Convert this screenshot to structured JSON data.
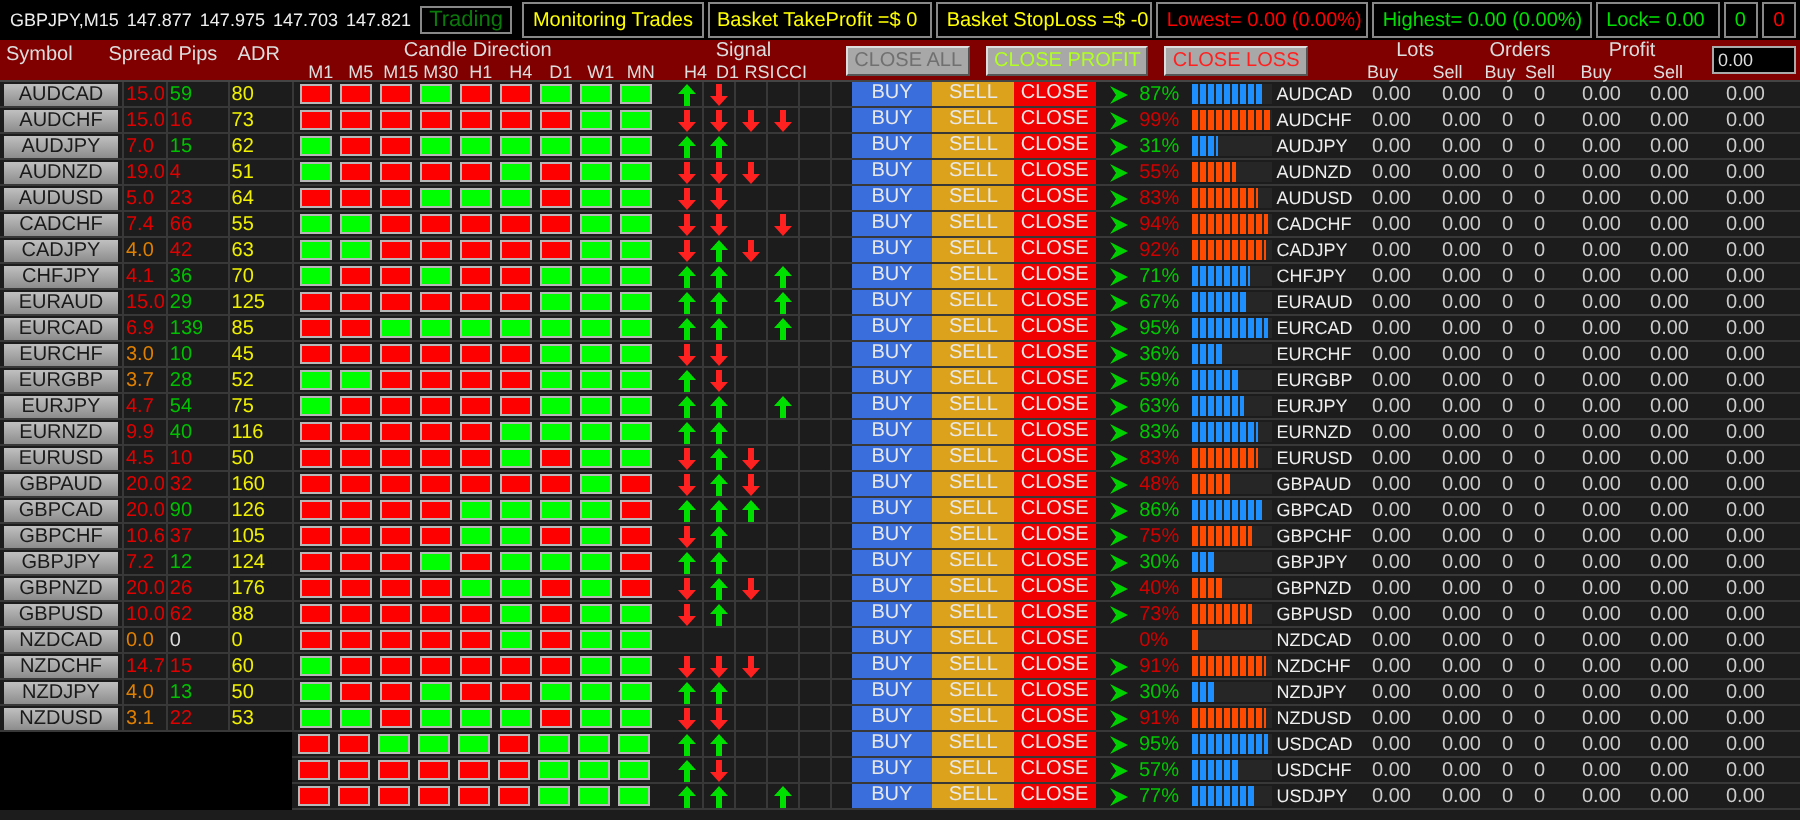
{
  "chart_info": {
    "symbol_timeframe": "GBPJPY,M15",
    "quotes": [
      "147.877",
      "147.975",
      "147.703",
      "147.821"
    ],
    "mode": "Trading"
  },
  "top_panels": [
    {
      "text": "Monitoring Trades",
      "color": "#ffff00"
    },
    {
      "text": "Basket TakeProfit =$ 0",
      "color": "#ffff00"
    },
    {
      "text": "Basket StopLoss =$ -0",
      "color": "#ffff00"
    },
    {
      "text": "Lowest= 0.00 (0.00%)",
      "color": "#ff0000"
    },
    {
      "text": "Highest= 0.00 (0.00%)",
      "color": "#00e000"
    },
    {
      "text": "Lock= 0.00",
      "color": "#00e000"
    }
  ],
  "counters": [
    {
      "text": "0",
      "color": "#00e000"
    },
    {
      "text": "0",
      "color": "#ff0000"
    }
  ],
  "header": {
    "columns": [
      "Symbol",
      "Spread",
      "Pips",
      "ADR"
    ],
    "candle_title": "Candle Direction",
    "timeframes": [
      "M1",
      "M5",
      "M15",
      "M30",
      "H1",
      "H4",
      "D1",
      "W1",
      "MN"
    ],
    "signal_title": "Signal",
    "signal_names": [
      "H4",
      "D1",
      "RSI",
      "CCI"
    ],
    "actions": [
      {
        "label": "CLOSE ALL",
        "kind": "all"
      },
      {
        "label": "CLOSE PROFIT",
        "kind": "profit"
      },
      {
        "label": "CLOSE LOSS",
        "kind": "loss"
      }
    ],
    "groups": [
      {
        "title": "Lots",
        "sub": [
          "Buy",
          "Sell"
        ]
      },
      {
        "title": "Orders",
        "sub": [
          "Buy",
          "Sell"
        ]
      },
      {
        "title": "Profit",
        "sub": [
          "Buy",
          "Sell"
        ]
      }
    ],
    "total_field": "0.00"
  },
  "rows": [
    {
      "symbol": "AUDCAD",
      "spread": {
        "text": "15.0",
        "color": "#e00000"
      },
      "pips": {
        "text": "59",
        "color": "#00c000"
      },
      "adr": "80",
      "candles_bullish": [
        false,
        false,
        false,
        true,
        false,
        false,
        true,
        true,
        true
      ],
      "signals": [
        {
          "kind": "up"
        },
        {
          "kind": "down"
        },
        {
          "kind": "none"
        },
        {
          "kind": "none"
        }
      ],
      "buttons": [
        "BUY",
        "SELL",
        "CLOSE"
      ],
      "arrow": true,
      "strength": "87%",
      "bullish": true,
      "level": 0.87,
      "pair": "AUDCAD",
      "values": [
        "0.00",
        "0.00",
        "0",
        "0",
        "0.00",
        "0.00",
        "0.00"
      ]
    },
    {
      "symbol": "AUDCHF",
      "spread": {
        "text": "15.0",
        "color": "#e00000"
      },
      "pips": {
        "text": "16",
        "color": "#e00000"
      },
      "adr": "73",
      "candles_bullish": [
        false,
        false,
        false,
        false,
        false,
        false,
        false,
        true,
        true
      ],
      "signals": [
        {
          "kind": "down"
        },
        {
          "kind": "down"
        },
        {
          "kind": "down"
        },
        {
          "kind": "down"
        }
      ],
      "buttons": [
        "BUY",
        "SELL",
        "CLOSE"
      ],
      "arrow": true,
      "strength": "99%",
      "bullish": false,
      "level": 0.99,
      "pair": "AUDCHF",
      "values": [
        "0.00",
        "0.00",
        "0",
        "0",
        "0.00",
        "0.00",
        "0.00"
      ]
    },
    {
      "symbol": "AUDJPY",
      "spread": {
        "text": "7.0",
        "color": "#e00000"
      },
      "pips": {
        "text": "15",
        "color": "#00c000"
      },
      "adr": "62",
      "candles_bullish": [
        true,
        false,
        false,
        true,
        true,
        true,
        true,
        true,
        true
      ],
      "signals": [
        {
          "kind": "up"
        },
        {
          "kind": "up"
        },
        {
          "kind": "none"
        },
        {
          "kind": "none"
        }
      ],
      "buttons": [
        "BUY",
        "SELL",
        "CLOSE"
      ],
      "arrow": true,
      "strength": "31%",
      "bullish": true,
      "level": 0.31,
      "pair": "AUDJPY",
      "values": [
        "0.00",
        "0.00",
        "0",
        "0",
        "0.00",
        "0.00",
        "0.00"
      ]
    },
    {
      "symbol": "AUDNZD",
      "spread": {
        "text": "19.0",
        "color": "#e00000"
      },
      "pips": {
        "text": "4",
        "color": "#e00000"
      },
      "adr": "51",
      "candles_bullish": [
        true,
        false,
        false,
        false,
        false,
        true,
        false,
        true,
        true
      ],
      "signals": [
        {
          "kind": "down"
        },
        {
          "kind": "down"
        },
        {
          "kind": "down"
        },
        {
          "kind": "none"
        }
      ],
      "buttons": [
        "BUY",
        "SELL",
        "CLOSE"
      ],
      "arrow": true,
      "strength": "55%",
      "bullish": false,
      "level": 0.55,
      "pair": "AUDNZD",
      "values": [
        "0.00",
        "0.00",
        "0",
        "0",
        "0.00",
        "0.00",
        "0.00"
      ]
    },
    {
      "symbol": "AUDUSD",
      "spread": {
        "text": "5.0",
        "color": "#e00000"
      },
      "pips": {
        "text": "23",
        "color": "#e00000"
      },
      "adr": "64",
      "candles_bullish": [
        false,
        false,
        false,
        true,
        true,
        true,
        false,
        true,
        true
      ],
      "signals": [
        {
          "kind": "down"
        },
        {
          "kind": "down"
        },
        {
          "kind": "none"
        },
        {
          "kind": "none"
        }
      ],
      "buttons": [
        "BUY",
        "SELL",
        "CLOSE"
      ],
      "arrow": true,
      "strength": "83%",
      "bullish": false,
      "level": 0.83,
      "pair": "AUDUSD",
      "values": [
        "0.00",
        "0.00",
        "0",
        "0",
        "0.00",
        "0.00",
        "0.00"
      ]
    },
    {
      "symbol": "CADCHF",
      "spread": {
        "text": "7.4",
        "color": "#e00000"
      },
      "pips": {
        "text": "66",
        "color": "#e00000"
      },
      "adr": "55",
      "candles_bullish": [
        true,
        true,
        false,
        false,
        false,
        false,
        false,
        true,
        true
      ],
      "signals": [
        {
          "kind": "down"
        },
        {
          "kind": "down"
        },
        {
          "kind": "none"
        },
        {
          "kind": "down"
        }
      ],
      "buttons": [
        "BUY",
        "SELL",
        "CLOSE"
      ],
      "arrow": true,
      "strength": "94%",
      "bullish": false,
      "level": 0.94,
      "pair": "CADCHF",
      "values": [
        "0.00",
        "0.00",
        "0",
        "0",
        "0.00",
        "0.00",
        "0.00"
      ]
    },
    {
      "symbol": "CADJPY",
      "spread": {
        "text": "4.0",
        "color": "#e08000"
      },
      "pips": {
        "text": "42",
        "color": "#e00000"
      },
      "adr": "63",
      "candles_bullish": [
        true,
        true,
        false,
        false,
        false,
        false,
        false,
        true,
        true
      ],
      "signals": [
        {
          "kind": "down"
        },
        {
          "kind": "up"
        },
        {
          "kind": "down"
        },
        {
          "kind": "none"
        }
      ],
      "buttons": [
        "BUY",
        "SELL",
        "CLOSE"
      ],
      "arrow": true,
      "strength": "92%",
      "bullish": false,
      "level": 0.92,
      "pair": "CADJPY",
      "values": [
        "0.00",
        "0.00",
        "0",
        "0",
        "0.00",
        "0.00",
        "0.00"
      ]
    },
    {
      "symbol": "CHFJPY",
      "spread": {
        "text": "4.1",
        "color": "#e00000"
      },
      "pips": {
        "text": "36",
        "color": "#00c000"
      },
      "adr": "70",
      "candles_bullish": [
        true,
        false,
        false,
        true,
        false,
        false,
        true,
        true,
        true
      ],
      "signals": [
        {
          "kind": "up"
        },
        {
          "kind": "up"
        },
        {
          "kind": "none"
        },
        {
          "kind": "up"
        }
      ],
      "buttons": [
        "BUY",
        "SELL",
        "CLOSE"
      ],
      "arrow": true,
      "strength": "71%",
      "bullish": true,
      "level": 0.71,
      "pair": "CHFJPY",
      "values": [
        "0.00",
        "0.00",
        "0",
        "0",
        "0.00",
        "0.00",
        "0.00"
      ]
    },
    {
      "symbol": "EURAUD",
      "spread": {
        "text": "15.0",
        "color": "#e00000"
      },
      "pips": {
        "text": "29",
        "color": "#00c000"
      },
      "adr": "125",
      "candles_bullish": [
        false,
        false,
        false,
        false,
        false,
        false,
        true,
        true,
        true
      ],
      "signals": [
        {
          "kind": "up"
        },
        {
          "kind": "up"
        },
        {
          "kind": "none"
        },
        {
          "kind": "up"
        }
      ],
      "buttons": [
        "BUY",
        "SELL",
        "CLOSE"
      ],
      "arrow": true,
      "strength": "67%",
      "bullish": true,
      "level": 0.67,
      "pair": "EURAUD",
      "values": [
        "0.00",
        "0.00",
        "0",
        "0",
        "0.00",
        "0.00",
        "0.00"
      ]
    },
    {
      "symbol": "EURCAD",
      "spread": {
        "text": "6.9",
        "color": "#e00000"
      },
      "pips": {
        "text": "139",
        "color": "#00c000"
      },
      "adr": "85",
      "candles_bullish": [
        false,
        false,
        true,
        true,
        true,
        true,
        true,
        true,
        true
      ],
      "signals": [
        {
          "kind": "up"
        },
        {
          "kind": "up"
        },
        {
          "kind": "none"
        },
        {
          "kind": "up"
        }
      ],
      "buttons": [
        "BUY",
        "SELL",
        "CLOSE"
      ],
      "arrow": true,
      "strength": "95%",
      "bullish": true,
      "level": 0.95,
      "pair": "EURCAD",
      "values": [
        "0.00",
        "0.00",
        "0",
        "0",
        "0.00",
        "0.00",
        "0.00"
      ]
    },
    {
      "symbol": "EURCHF",
      "spread": {
        "text": "3.0",
        "color": "#e08000"
      },
      "pips": {
        "text": "10",
        "color": "#00c000"
      },
      "adr": "45",
      "candles_bullish": [
        false,
        false,
        false,
        false,
        false,
        false,
        true,
        true,
        true
      ],
      "signals": [
        {
          "kind": "down"
        },
        {
          "kind": "down"
        },
        {
          "kind": "none"
        },
        {
          "kind": "none"
        }
      ],
      "buttons": [
        "BUY",
        "SELL",
        "CLOSE"
      ],
      "arrow": true,
      "strength": "36%",
      "bullish": true,
      "level": 0.36,
      "pair": "EURCHF",
      "values": [
        "0.00",
        "0.00",
        "0",
        "0",
        "0.00",
        "0.00",
        "0.00"
      ]
    },
    {
      "symbol": "EURGBP",
      "spread": {
        "text": "3.7",
        "color": "#e08000"
      },
      "pips": {
        "text": "28",
        "color": "#00c000"
      },
      "adr": "52",
      "candles_bullish": [
        true,
        true,
        false,
        false,
        false,
        false,
        true,
        true,
        true
      ],
      "signals": [
        {
          "kind": "up"
        },
        {
          "kind": "down"
        },
        {
          "kind": "none"
        },
        {
          "kind": "none"
        }
      ],
      "buttons": [
        "BUY",
        "SELL",
        "CLOSE"
      ],
      "arrow": true,
      "strength": "59%",
      "bullish": true,
      "level": 0.59,
      "pair": "EURGBP",
      "values": [
        "0.00",
        "0.00",
        "0",
        "0",
        "0.00",
        "0.00",
        "0.00"
      ]
    },
    {
      "symbol": "EURJPY",
      "spread": {
        "text": "4.7",
        "color": "#e00000"
      },
      "pips": {
        "text": "54",
        "color": "#00c000"
      },
      "adr": "75",
      "candles_bullish": [
        true,
        false,
        false,
        false,
        false,
        false,
        true,
        true,
        true
      ],
      "signals": [
        {
          "kind": "up"
        },
        {
          "kind": "up"
        },
        {
          "kind": "none"
        },
        {
          "kind": "up"
        }
      ],
      "buttons": [
        "BUY",
        "SELL",
        "CLOSE"
      ],
      "arrow": true,
      "strength": "63%",
      "bullish": true,
      "level": 0.63,
      "pair": "EURJPY",
      "values": [
        "0.00",
        "0.00",
        "0",
        "0",
        "0.00",
        "0.00",
        "0.00"
      ]
    },
    {
      "symbol": "EURNZD",
      "spread": {
        "text": "9.9",
        "color": "#e00000"
      },
      "pips": {
        "text": "40",
        "color": "#00c000"
      },
      "adr": "116",
      "candles_bullish": [
        false,
        false,
        false,
        false,
        false,
        true,
        true,
        true,
        true
      ],
      "signals": [
        {
          "kind": "up"
        },
        {
          "kind": "up"
        },
        {
          "kind": "none"
        },
        {
          "kind": "none"
        }
      ],
      "buttons": [
        "BUY",
        "SELL",
        "CLOSE"
      ],
      "arrow": true,
      "strength": "83%",
      "bullish": true,
      "level": 0.83,
      "pair": "EURNZD",
      "values": [
        "0.00",
        "0.00",
        "0",
        "0",
        "0.00",
        "0.00",
        "0.00"
      ]
    },
    {
      "symbol": "EURUSD",
      "spread": {
        "text": "4.5",
        "color": "#e00000"
      },
      "pips": {
        "text": "10",
        "color": "#e00000"
      },
      "adr": "50",
      "candles_bullish": [
        false,
        false,
        false,
        false,
        false,
        true,
        false,
        true,
        true
      ],
      "signals": [
        {
          "kind": "down"
        },
        {
          "kind": "up"
        },
        {
          "kind": "down"
        },
        {
          "kind": "none"
        }
      ],
      "buttons": [
        "BUY",
        "SELL",
        "CLOSE"
      ],
      "arrow": true,
      "strength": "83%",
      "bullish": false,
      "level": 0.83,
      "pair": "EURUSD",
      "values": [
        "0.00",
        "0.00",
        "0",
        "0",
        "0.00",
        "0.00",
        "0.00"
      ]
    },
    {
      "symbol": "GBPAUD",
      "spread": {
        "text": "20.0",
        "color": "#e00000"
      },
      "pips": {
        "text": "32",
        "color": "#e00000"
      },
      "adr": "160",
      "candles_bullish": [
        false,
        false,
        false,
        false,
        false,
        false,
        false,
        true,
        false
      ],
      "signals": [
        {
          "kind": "down"
        },
        {
          "kind": "up"
        },
        {
          "kind": "down"
        },
        {
          "kind": "none"
        }
      ],
      "buttons": [
        "BUY",
        "SELL",
        "CLOSE"
      ],
      "arrow": true,
      "strength": "48%",
      "bullish": false,
      "level": 0.48,
      "pair": "GBPAUD",
      "values": [
        "0.00",
        "0.00",
        "0",
        "0",
        "0.00",
        "0.00",
        "0.00"
      ]
    },
    {
      "symbol": "GBPCAD",
      "spread": {
        "text": "20.0",
        "color": "#e00000"
      },
      "pips": {
        "text": "90",
        "color": "#00c000"
      },
      "adr": "126",
      "candles_bullish": [
        false,
        false,
        false,
        false,
        true,
        true,
        true,
        true,
        false
      ],
      "signals": [
        {
          "kind": "up"
        },
        {
          "kind": "up"
        },
        {
          "kind": "up"
        },
        {
          "kind": "none"
        }
      ],
      "buttons": [
        "BUY",
        "SELL",
        "CLOSE"
      ],
      "arrow": true,
      "strength": "86%",
      "bullish": true,
      "level": 0.86,
      "pair": "GBPCAD",
      "values": [
        "0.00",
        "0.00",
        "0",
        "0",
        "0.00",
        "0.00",
        "0.00"
      ]
    },
    {
      "symbol": "GBPCHF",
      "spread": {
        "text": "10.6",
        "color": "#e00000"
      },
      "pips": {
        "text": "37",
        "color": "#e00000"
      },
      "adr": "105",
      "candles_bullish": [
        false,
        false,
        false,
        false,
        true,
        true,
        false,
        true,
        false
      ],
      "signals": [
        {
          "kind": "down"
        },
        {
          "kind": "up"
        },
        {
          "kind": "none"
        },
        {
          "kind": "none"
        }
      ],
      "buttons": [
        "BUY",
        "SELL",
        "CLOSE"
      ],
      "arrow": true,
      "strength": "75%",
      "bullish": false,
      "level": 0.75,
      "pair": "GBPCHF",
      "values": [
        "0.00",
        "0.00",
        "0",
        "0",
        "0.00",
        "0.00",
        "0.00"
      ]
    },
    {
      "symbol": "GBPJPY",
      "spread": {
        "text": "7.2",
        "color": "#e00000"
      },
      "pips": {
        "text": "12",
        "color": "#00c000"
      },
      "adr": "124",
      "candles_bullish": [
        false,
        false,
        false,
        true,
        false,
        true,
        true,
        true,
        false
      ],
      "signals": [
        {
          "kind": "up"
        },
        {
          "kind": "up"
        },
        {
          "kind": "none"
        },
        {
          "kind": "none"
        }
      ],
      "buttons": [
        "BUY",
        "SELL",
        "CLOSE"
      ],
      "arrow": true,
      "strength": "30%",
      "bullish": true,
      "level": 0.3,
      "pair": "GBPJPY",
      "values": [
        "0.00",
        "0.00",
        "0",
        "0",
        "0.00",
        "0.00",
        "0.00"
      ]
    },
    {
      "symbol": "GBPNZD",
      "spread": {
        "text": "20.0",
        "color": "#e00000"
      },
      "pips": {
        "text": "26",
        "color": "#e00000"
      },
      "adr": "176",
      "candles_bullish": [
        false,
        false,
        false,
        false,
        true,
        true,
        false,
        true,
        false
      ],
      "signals": [
        {
          "kind": "down"
        },
        {
          "kind": "up"
        },
        {
          "kind": "down"
        },
        {
          "kind": "none"
        }
      ],
      "buttons": [
        "BUY",
        "SELL",
        "CLOSE"
      ],
      "arrow": true,
      "strength": "40%",
      "bullish": false,
      "level": 0.4,
      "pair": "GBPNZD",
      "values": [
        "0.00",
        "0.00",
        "0",
        "0",
        "0.00",
        "0.00",
        "0.00"
      ]
    },
    {
      "symbol": "GBPUSD",
      "spread": {
        "text": "10.0",
        "color": "#e00000"
      },
      "pips": {
        "text": "62",
        "color": "#e00000"
      },
      "adr": "88",
      "candles_bullish": [
        false,
        false,
        false,
        false,
        false,
        true,
        false,
        true,
        true
      ],
      "signals": [
        {
          "kind": "down"
        },
        {
          "kind": "up"
        },
        {
          "kind": "none"
        },
        {
          "kind": "none"
        }
      ],
      "buttons": [
        "BUY",
        "SELL",
        "CLOSE"
      ],
      "arrow": true,
      "strength": "73%",
      "bullish": false,
      "level": 0.73,
      "pair": "GBPUSD",
      "values": [
        "0.00",
        "0.00",
        "0",
        "0",
        "0.00",
        "0.00",
        "0.00"
      ]
    },
    {
      "symbol": "NZDCAD",
      "spread": {
        "text": "0.0",
        "color": "#e08000"
      },
      "pips": {
        "text": "0",
        "color": "#dddddd"
      },
      "adr": "0",
      "candles_bullish": [
        false,
        false,
        false,
        false,
        false,
        true,
        false,
        true,
        true
      ],
      "signals": [
        {
          "kind": "none"
        },
        {
          "kind": "none"
        },
        {
          "kind": "none"
        },
        {
          "kind": "none"
        }
      ],
      "buttons": [
        "BUY",
        "SELL",
        "CLOSE"
      ],
      "arrow": false,
      "strength": "0%",
      "bullish": false,
      "level": 0.1,
      "pair": "NZDCAD",
      "values": [
        "0.00",
        "0.00",
        "0",
        "0",
        "0.00",
        "0.00",
        "0.00"
      ]
    },
    {
      "symbol": "NZDCHF",
      "spread": {
        "text": "14.7",
        "color": "#e00000"
      },
      "pips": {
        "text": "15",
        "color": "#e00000"
      },
      "adr": "60",
      "candles_bullish": [
        true,
        false,
        false,
        false,
        false,
        false,
        false,
        true,
        true
      ],
      "signals": [
        {
          "kind": "down"
        },
        {
          "kind": "down"
        },
        {
          "kind": "down"
        },
        {
          "kind": "none"
        }
      ],
      "buttons": [
        "BUY",
        "SELL",
        "CLOSE"
      ],
      "arrow": true,
      "strength": "91%",
      "bullish": false,
      "level": 0.91,
      "pair": "NZDCHF",
      "values": [
        "0.00",
        "0.00",
        "0",
        "0",
        "0.00",
        "0.00",
        "0.00"
      ]
    },
    {
      "symbol": "NZDJPY",
      "spread": {
        "text": "4.0",
        "color": "#e08000"
      },
      "pips": {
        "text": "13",
        "color": "#00c000"
      },
      "adr": "50",
      "candles_bullish": [
        true,
        false,
        false,
        true,
        false,
        false,
        true,
        true,
        true
      ],
      "signals": [
        {
          "kind": "up"
        },
        {
          "kind": "up"
        },
        {
          "kind": "none"
        },
        {
          "kind": "none"
        }
      ],
      "buttons": [
        "BUY",
        "SELL",
        "CLOSE"
      ],
      "arrow": true,
      "strength": "30%",
      "bullish": true,
      "level": 0.3,
      "pair": "NZDJPY",
      "values": [
        "0.00",
        "0.00",
        "0",
        "0",
        "0.00",
        "0.00",
        "0.00"
      ]
    },
    {
      "symbol": "NZDUSD",
      "spread": {
        "text": "3.1",
        "color": "#e08000"
      },
      "pips": {
        "text": "22",
        "color": "#e00000"
      },
      "adr": "53",
      "candles_bullish": [
        true,
        true,
        false,
        true,
        true,
        true,
        false,
        true,
        true
      ],
      "signals": [
        {
          "kind": "down"
        },
        {
          "kind": "down"
        },
        {
          "kind": "none"
        },
        {
          "kind": "none"
        }
      ],
      "buttons": [
        "BUY",
        "SELL",
        "CLOSE"
      ],
      "arrow": true,
      "strength": "91%",
      "bullish": false,
      "level": 0.91,
      "pair": "NZDUSD",
      "values": [
        "0.00",
        "0.00",
        "0",
        "0",
        "0.00",
        "0.00",
        "0.00"
      ]
    },
    {
      "candles_bullish": [
        false,
        false,
        true,
        true,
        true,
        false,
        true,
        true,
        true
      ],
      "signals": [
        {
          "kind": "up"
        },
        {
          "kind": "up"
        },
        {
          "kind": "none"
        },
        {
          "kind": "none"
        }
      ],
      "buttons": [
        "BUY",
        "SELL",
        "CLOSE"
      ],
      "arrow": true,
      "strength": "95%",
      "bullish": true,
      "level": 0.95,
      "pair": "USDCAD",
      "values": [
        "0.00",
        "0.00",
        "0",
        "0",
        "0.00",
        "0.00",
        "0.00"
      ]
    },
    {
      "candles_bullish": [
        false,
        false,
        false,
        false,
        false,
        false,
        true,
        true,
        true
      ],
      "signals": [
        {
          "kind": "up"
        },
        {
          "kind": "down"
        },
        {
          "kind": "none"
        },
        {
          "kind": "none"
        }
      ],
      "buttons": [
        "BUY",
        "SELL",
        "CLOSE"
      ],
      "arrow": true,
      "strength": "57%",
      "bullish": true,
      "level": 0.57,
      "pair": "USDCHF",
      "values": [
        "0.00",
        "0.00",
        "0",
        "0",
        "0.00",
        "0.00",
        "0.00"
      ]
    },
    {
      "candles_bullish": [
        false,
        false,
        false,
        false,
        false,
        false,
        true,
        true,
        true
      ],
      "signals": [
        {
          "kind": "up"
        },
        {
          "kind": "up"
        },
        {
          "kind": "none"
        },
        {
          "kind": "up"
        }
      ],
      "buttons": [
        "BUY",
        "SELL",
        "CLOSE"
      ],
      "arrow": true,
      "strength": "77%",
      "bullish": true,
      "level": 0.77,
      "pair": "USDJPY",
      "values": [
        "0.00",
        "0.00",
        "0",
        "0",
        "0.00",
        "0.00",
        "0.00"
      ]
    }
  ]
}
